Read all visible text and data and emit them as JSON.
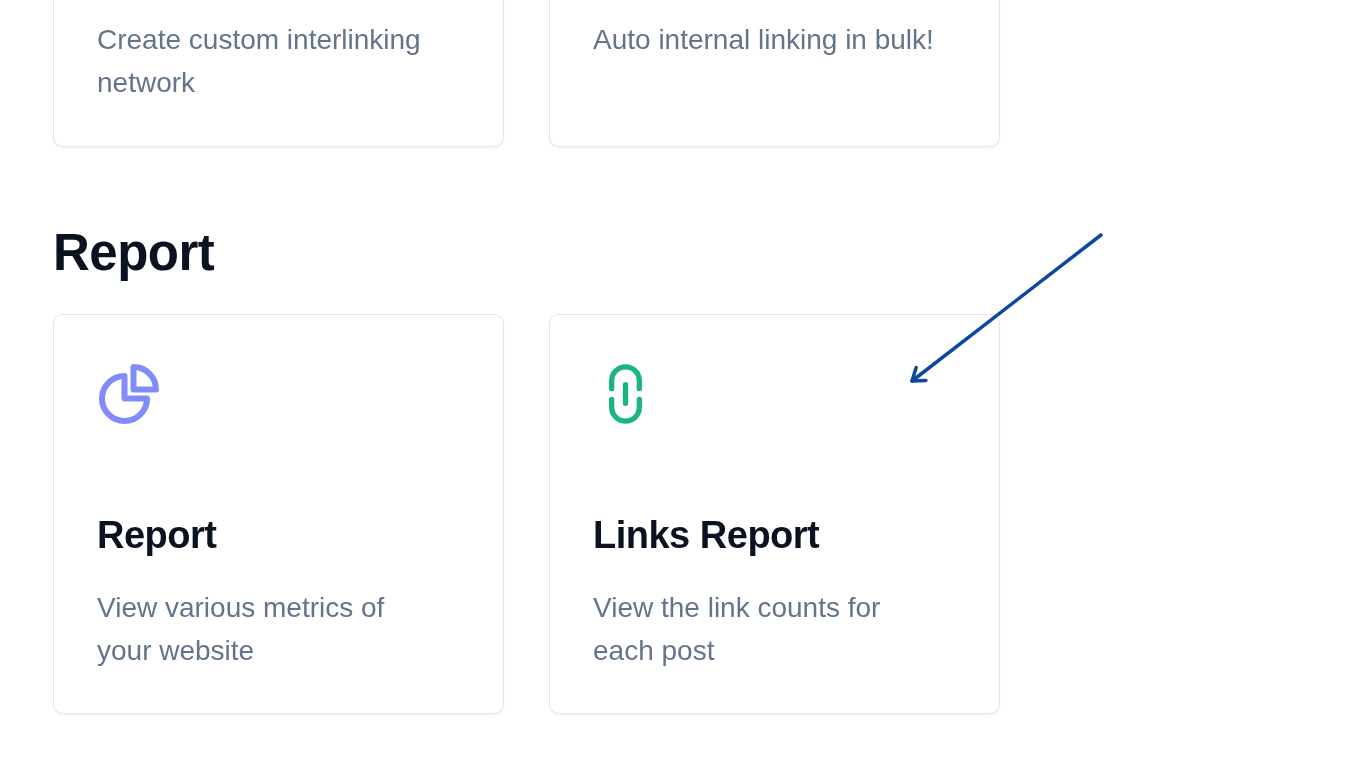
{
  "previous_section": {
    "cards": [
      {
        "description": "Create custom interlinking network"
      },
      {
        "description": "Auto internal linking in bulk!"
      }
    ]
  },
  "sections": [
    {
      "heading": "Report",
      "cards": [
        {
          "kind": "pie-chart",
          "title": "Report",
          "description": "View various metrics of your website"
        },
        {
          "kind": "link",
          "title": "Links Report",
          "description": "View the link counts for each post"
        }
      ]
    }
  ]
}
